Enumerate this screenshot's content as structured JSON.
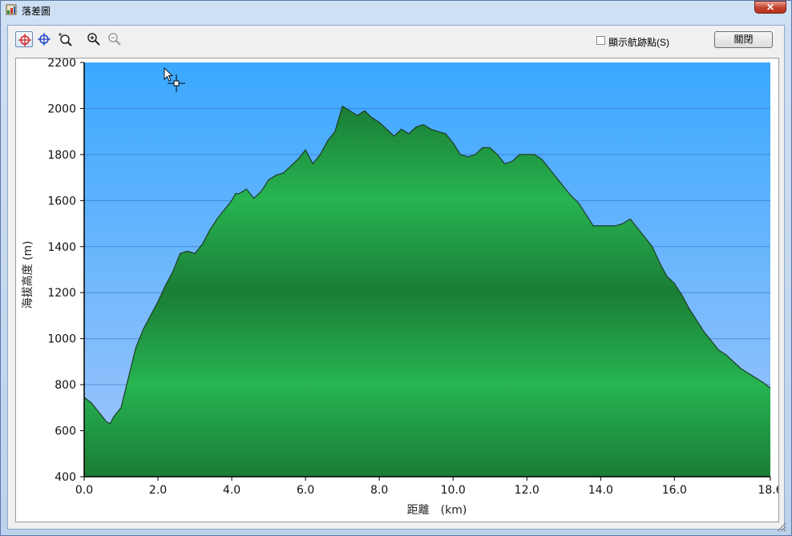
{
  "window": {
    "title": "落差圖",
    "close_glyph": "✕"
  },
  "toolbar": {
    "tools": [
      {
        "name": "red-crosshair-tool-icon",
        "active": true
      },
      {
        "name": "blue-crosshair-tool-icon",
        "active": false
      },
      {
        "name": "zoom-region-icon",
        "active": false
      },
      {
        "name": "zoom-in-icon",
        "active": false
      },
      {
        "name": "zoom-out-icon",
        "active": false
      }
    ],
    "show_track_points_label": "顯示航跡點(S)",
    "show_track_points_checked": false,
    "close_label": "關閉"
  },
  "colors": {
    "sky_top": "#3aa8ff",
    "sky_bottom": "#a2c6fb",
    "fill_light": "#27b452",
    "fill_dark": "#1a7d35",
    "outline": "#1e3b23",
    "gridline": "#2e6ab3"
  },
  "chart_data": {
    "type": "area",
    "title": "",
    "xlabel": "距離　(km)",
    "ylabel": "海拔高度 (m)",
    "xlim": [
      0,
      18.6
    ],
    "ylim": [
      400,
      2200
    ],
    "x_ticks": [
      0,
      2,
      4,
      6,
      8,
      10,
      12,
      14,
      16,
      18.6
    ],
    "x_tick_labels": [
      "0.0",
      "2.0",
      "4.0",
      "6.0",
      "8.0",
      "10.0",
      "12.0",
      "14.0",
      "16.0",
      "18.6"
    ],
    "y_ticks": [
      400,
      600,
      800,
      1000,
      1200,
      1400,
      1600,
      1800,
      2000,
      2200
    ],
    "y_tick_labels": [
      "400",
      "600",
      "800",
      "1000",
      "1200",
      "1400",
      "1600",
      "1800",
      "2000",
      "2200"
    ],
    "grid": true,
    "legend": "none",
    "x": [
      0,
      0.2,
      0.4,
      0.6,
      0.7,
      0.8,
      1.0,
      1.2,
      1.4,
      1.6,
      1.8,
      2.0,
      2.2,
      2.4,
      2.6,
      2.8,
      3.0,
      3.2,
      3.4,
      3.6,
      3.8,
      4.0,
      4.1,
      4.2,
      4.4,
      4.6,
      4.8,
      5.0,
      5.2,
      5.4,
      5.6,
      5.8,
      6.0,
      6.2,
      6.4,
      6.6,
      6.8,
      7.0,
      7.2,
      7.4,
      7.6,
      7.8,
      8.0,
      8.2,
      8.4,
      8.6,
      8.8,
      9.0,
      9.2,
      9.4,
      9.6,
      9.8,
      10.0,
      10.2,
      10.4,
      10.6,
      10.8,
      11.0,
      11.2,
      11.4,
      11.6,
      11.8,
      12.0,
      12.2,
      12.4,
      12.6,
      12.8,
      13.0,
      13.2,
      13.4,
      13.6,
      13.8,
      14.0,
      14.2,
      14.4,
      14.6,
      14.8,
      15.0,
      15.2,
      15.4,
      15.6,
      15.8,
      16.0,
      16.2,
      16.4,
      16.6,
      16.8,
      17.0,
      17.2,
      17.4,
      17.6,
      17.8,
      18.0,
      18.2,
      18.4,
      18.6
    ],
    "y": [
      745,
      720,
      680,
      640,
      630,
      660,
      700,
      830,
      960,
      1040,
      1100,
      1160,
      1230,
      1290,
      1370,
      1380,
      1370,
      1410,
      1470,
      1520,
      1560,
      1600,
      1630,
      1630,
      1650,
      1610,
      1640,
      1690,
      1710,
      1720,
      1750,
      1780,
      1820,
      1760,
      1800,
      1860,
      1900,
      2010,
      1990,
      1970,
      1990,
      1960,
      1940,
      1910,
      1880,
      1910,
      1890,
      1920,
      1930,
      1910,
      1900,
      1890,
      1850,
      1800,
      1790,
      1800,
      1830,
      1830,
      1800,
      1760,
      1770,
      1800,
      1800,
      1800,
      1780,
      1740,
      1700,
      1660,
      1620,
      1590,
      1540,
      1490,
      1490,
      1490,
      1490,
      1500,
      1520,
      1480,
      1440,
      1400,
      1330,
      1270,
      1240,
      1190,
      1130,
      1080,
      1030,
      990,
      950,
      930,
      900,
      870,
      850,
      830,
      810,
      785
    ]
  }
}
